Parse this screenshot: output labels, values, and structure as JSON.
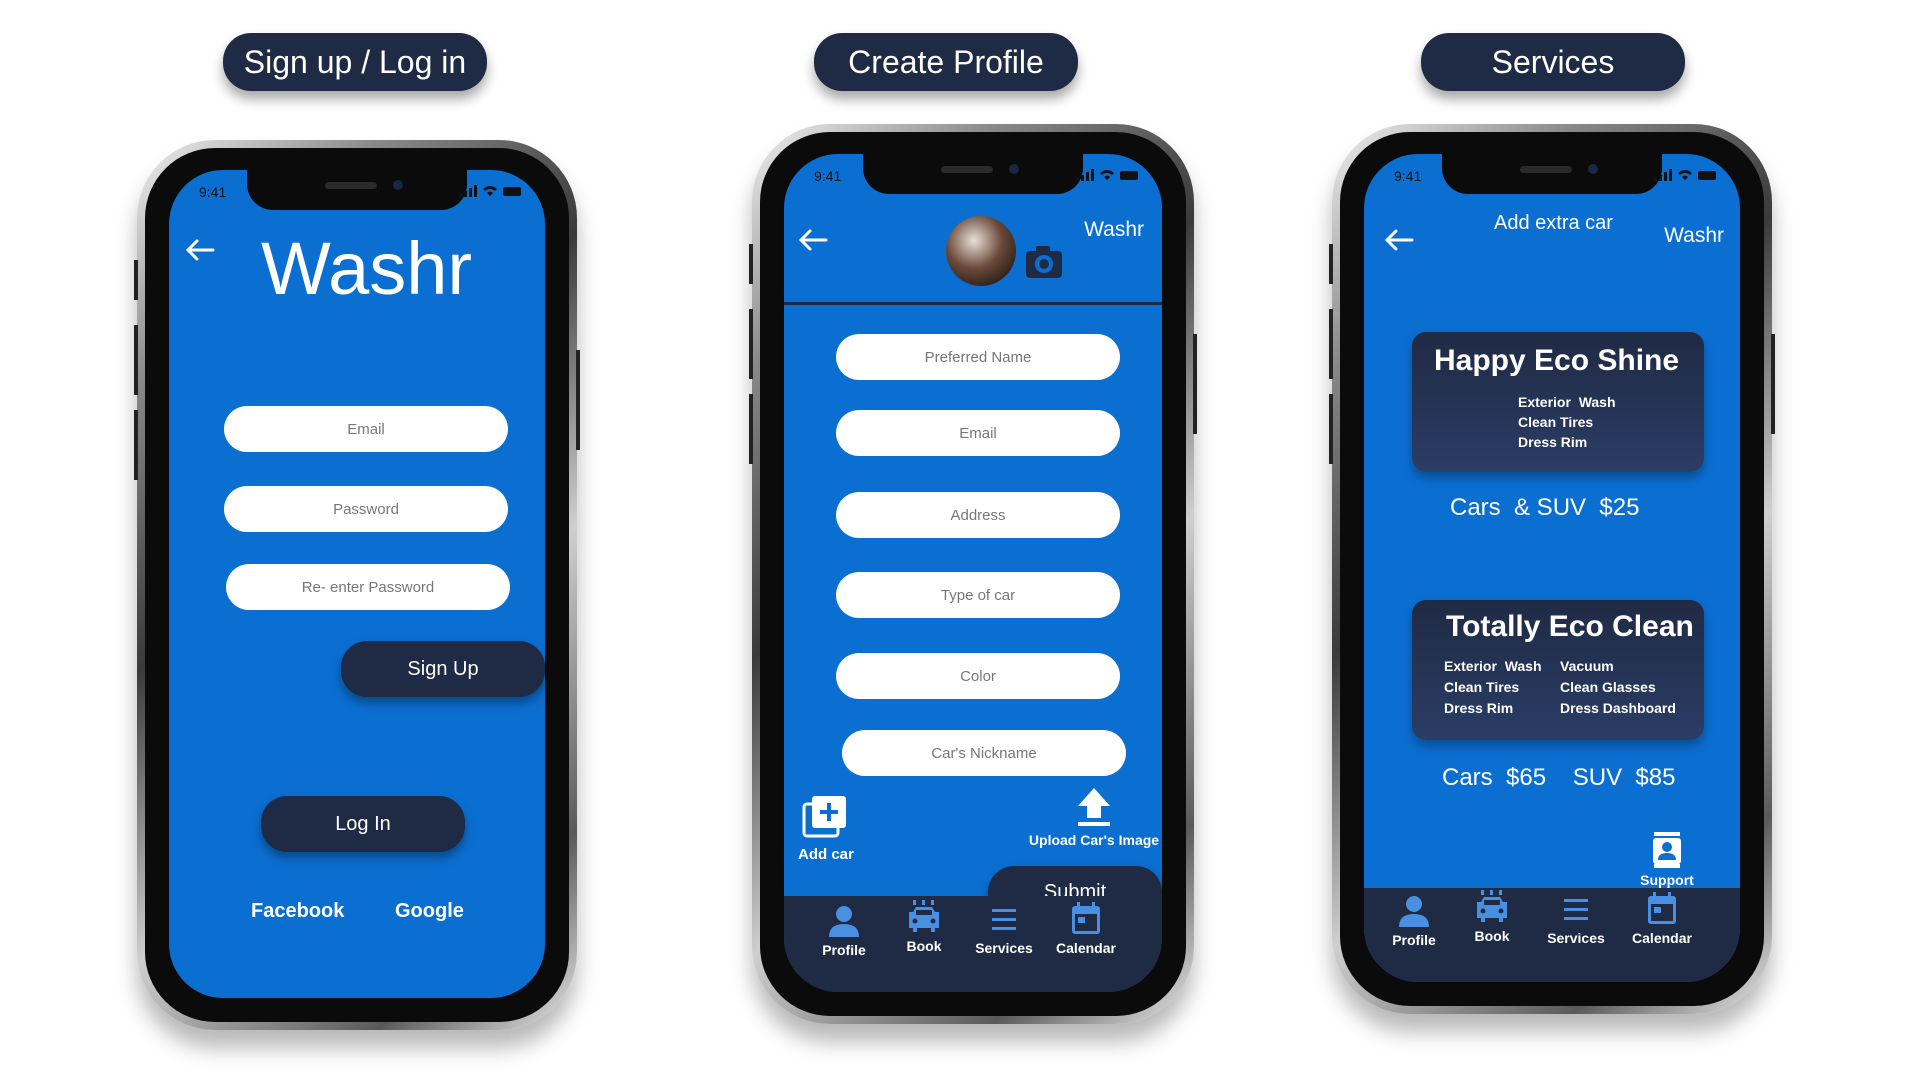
{
  "headers": {
    "signup": "Sign up / Log in",
    "create": "Create Profile",
    "services": "Services"
  },
  "status": {
    "time": "9:41"
  },
  "login": {
    "logo": "Washr",
    "email_placeholder": "Email",
    "password_placeholder": "Password",
    "reenter_placeholder": "Re- enter Password",
    "signup_label": "Sign Up",
    "login_label": "Log In",
    "facebook_label": "Facebook",
    "google_label": "Google"
  },
  "profile": {
    "brand": "Washr",
    "fields": [
      "Preferred Name",
      "Email",
      "Address",
      "Type of car",
      "Color",
      "Car's Nickname"
    ],
    "add_car_label": "Add car",
    "upload_label": "Upload Car's Image",
    "submit_label": "Submit"
  },
  "tabs": {
    "profile": "Profile",
    "book": "Book",
    "services": "Services",
    "calendar": "Calendar"
  },
  "services": {
    "add_extra_car": "Add extra car",
    "brand": "Washr",
    "card1": {
      "title": "Happy Eco Shine",
      "items": [
        "Exterior  Wash",
        "Clean Tires",
        "Dress Rim"
      ],
      "price": "Cars  & SUV  $25"
    },
    "card2": {
      "title": "Totally Eco Clean",
      "left_items": [
        "Exterior  Wash",
        "Clean Tires",
        "Dress Rim"
      ],
      "right_items": [
        "Vacuum",
        "Clean Glasses",
        "Dress Dashboard"
      ],
      "price": "Cars  $65    SUV  $85"
    },
    "support_label": "Support"
  },
  "colors": {
    "screen_blue": "#0b6fd2",
    "navy": "#1f2a44"
  },
  "icons": [
    "back-arrow-icon",
    "camera-icon",
    "add-box-icon",
    "upload-icon",
    "person-icon",
    "car-icon",
    "list-icon",
    "calendar-icon",
    "contact-icon",
    "signal-icon",
    "wifi-icon",
    "battery-icon"
  ]
}
